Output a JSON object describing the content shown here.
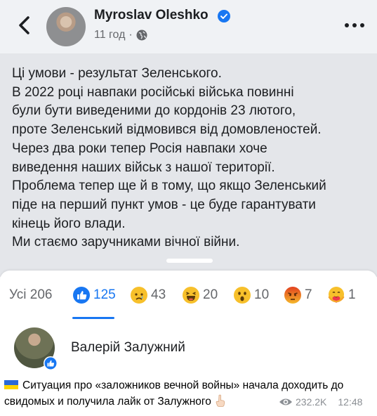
{
  "header": {
    "author": "Myroslav Oleshko",
    "time": "11 год",
    "back_icon": "chevron-left-icon",
    "verified_icon": "verified-badge-icon",
    "privacy_icon": "globe-icon",
    "more_icon": "more-dots-icon"
  },
  "post": {
    "text": "Ці умови - результат Зеленського.\nВ 2022 році навпаки російські війська повинні\nбули бути виведеними до кордонів 23 лютого,\nпроте Зеленський відмовився від домовленостей.\nЧерез два роки тепер Росія навпаки хоче\nвиведення наших військ з нашої території.\nПроблема тепер ще й в тому, що якщо Зеленський\nпіде на перший пункт умов - це буде гарантувати\nкінець його влади.\nМи стаємо заручниками вічної війни."
  },
  "reactions": {
    "all_label": "Усі 206",
    "items": [
      {
        "icon": "like-icon",
        "count": "125",
        "color": "#1877f2"
      },
      {
        "icon": "sad-icon",
        "count": "43",
        "color": "#f7c02b"
      },
      {
        "icon": "haha-icon",
        "count": "20",
        "color": "#f7c02b"
      },
      {
        "icon": "wow-icon",
        "count": "10",
        "color": "#f7c02b"
      },
      {
        "icon": "angry-icon",
        "count": "7",
        "color": "#e9710f"
      },
      {
        "icon": "care-icon",
        "count": "1",
        "color": "#f7c02b"
      }
    ]
  },
  "reactor": {
    "name": "Валерій Залужний",
    "badge_icon": "like-badge-icon"
  },
  "caption": {
    "flag_icon": "ukraine-flag-icon",
    "text": "Ситуация про «заложников вечной войны» начала доходить до свидомых и получила лайк от Залужного",
    "emoji_icon": "pointing-up-emoji-icon",
    "views": "232.2K",
    "time": "12:48",
    "views_icon": "eye-icon"
  },
  "colors": {
    "accent": "#1877f2",
    "header_bg": "#f0f2f5",
    "post_bg": "#e4e6ea",
    "muted_text": "#65676b"
  }
}
